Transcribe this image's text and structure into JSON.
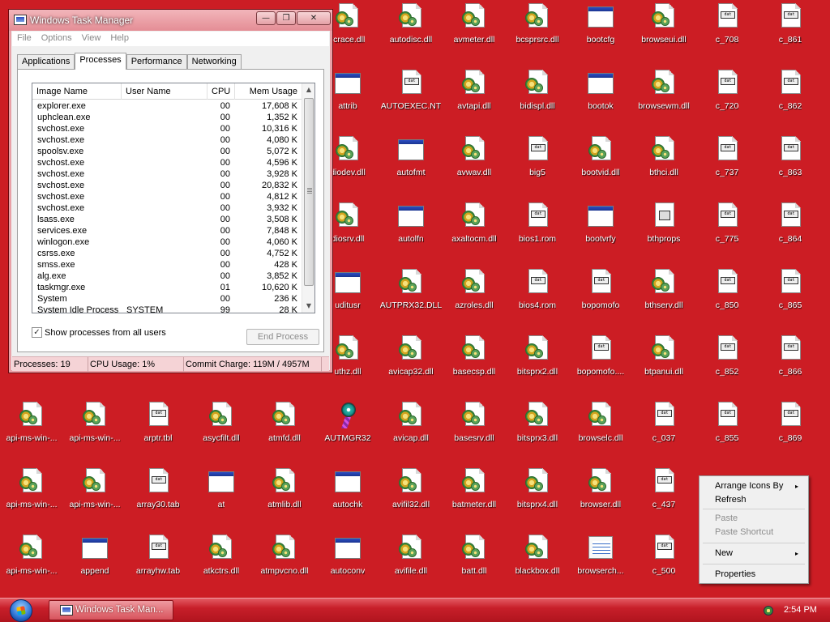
{
  "desktop": {
    "icons": [
      {
        "label": "rcrace.dll",
        "type": "dll",
        "col": 5,
        "row": 0
      },
      {
        "label": "autodisc.dll",
        "type": "dll",
        "col": 6,
        "row": 0
      },
      {
        "label": "avmeter.dll",
        "type": "dll",
        "col": 7,
        "row": 0
      },
      {
        "label": "bcsprsrc.dll",
        "type": "dll",
        "col": 8,
        "row": 0
      },
      {
        "label": "bootcfg",
        "type": "win",
        "col": 9,
        "row": 0
      },
      {
        "label": "browseui.dll",
        "type": "dll",
        "col": 10,
        "row": 0
      },
      {
        "label": "c_708",
        "type": "doc",
        "col": 11,
        "row": 0
      },
      {
        "label": "c_861",
        "type": "doc",
        "col": 12,
        "row": 0
      },
      {
        "label": "attrib",
        "type": "win",
        "col": 5,
        "row": 1
      },
      {
        "label": "AUTOEXEC.NT",
        "type": "doc",
        "col": 6,
        "row": 1
      },
      {
        "label": "avtapi.dll",
        "type": "dll",
        "col": 7,
        "row": 1
      },
      {
        "label": "bidispl.dll",
        "type": "dll",
        "col": 8,
        "row": 1
      },
      {
        "label": "bootok",
        "type": "win",
        "col": 9,
        "row": 1
      },
      {
        "label": "browsewm.dll",
        "type": "dll",
        "col": 10,
        "row": 1
      },
      {
        "label": "c_720",
        "type": "doc",
        "col": 11,
        "row": 1
      },
      {
        "label": "c_862",
        "type": "doc",
        "col": 12,
        "row": 1
      },
      {
        "label": "diodev.dll",
        "type": "dll",
        "col": 5,
        "row": 2
      },
      {
        "label": "autofmt",
        "type": "win",
        "col": 6,
        "row": 2
      },
      {
        "label": "avwav.dll",
        "type": "dll",
        "col": 7,
        "row": 2
      },
      {
        "label": "big5",
        "type": "doc",
        "col": 8,
        "row": 2
      },
      {
        "label": "bootvid.dll",
        "type": "dll",
        "col": 9,
        "row": 2
      },
      {
        "label": "bthci.dll",
        "type": "dll",
        "col": 10,
        "row": 2
      },
      {
        "label": "c_737",
        "type": "doc",
        "col": 11,
        "row": 2
      },
      {
        "label": "c_863",
        "type": "doc",
        "col": 12,
        "row": 2
      },
      {
        "label": "diosrv.dll",
        "type": "dll",
        "col": 5,
        "row": 3
      },
      {
        "label": "autolfn",
        "type": "win",
        "col": 6,
        "row": 3
      },
      {
        "label": "axaltocm.dll",
        "type": "dll",
        "col": 7,
        "row": 3
      },
      {
        "label": "bios1.rom",
        "type": "doc",
        "col": 8,
        "row": 3
      },
      {
        "label": "bootvrfy",
        "type": "win",
        "col": 9,
        "row": 3
      },
      {
        "label": "bthprops",
        "type": "sys",
        "col": 10,
        "row": 3
      },
      {
        "label": "c_775",
        "type": "doc",
        "col": 11,
        "row": 3
      },
      {
        "label": "c_864",
        "type": "doc",
        "col": 12,
        "row": 3
      },
      {
        "label": "uditusr",
        "type": "win",
        "col": 5,
        "row": 4
      },
      {
        "label": "AUTPRX32.DLL",
        "type": "dll",
        "col": 6,
        "row": 4
      },
      {
        "label": "azroles.dll",
        "type": "dll",
        "col": 7,
        "row": 4
      },
      {
        "label": "bios4.rom",
        "type": "doc",
        "col": 8,
        "row": 4
      },
      {
        "label": "bopomofo",
        "type": "doc",
        "col": 9,
        "row": 4
      },
      {
        "label": "bthserv.dll",
        "type": "dll",
        "col": 10,
        "row": 4
      },
      {
        "label": "c_850",
        "type": "doc",
        "col": 11,
        "row": 4
      },
      {
        "label": "c_865",
        "type": "doc",
        "col": 12,
        "row": 4
      },
      {
        "label": "uthz.dll",
        "type": "dll",
        "col": 5,
        "row": 5
      },
      {
        "label": "avicap32.dll",
        "type": "dll",
        "col": 6,
        "row": 5
      },
      {
        "label": "basecsp.dll",
        "type": "dll",
        "col": 7,
        "row": 5
      },
      {
        "label": "bitsprx2.dll",
        "type": "dll",
        "col": 8,
        "row": 5
      },
      {
        "label": "bopomofo....",
        "type": "doc",
        "col": 9,
        "row": 5
      },
      {
        "label": "btpanui.dll",
        "type": "dll",
        "col": 10,
        "row": 5
      },
      {
        "label": "c_852",
        "type": "doc",
        "col": 11,
        "row": 5
      },
      {
        "label": "c_866",
        "type": "doc",
        "col": 12,
        "row": 5
      },
      {
        "label": "api-ms-win-...",
        "type": "dll",
        "col": 0,
        "row": 6
      },
      {
        "label": "api-ms-win-...",
        "type": "dll",
        "col": 1,
        "row": 6
      },
      {
        "label": "arptr.tbl",
        "type": "doc",
        "col": 2,
        "row": 6
      },
      {
        "label": "asycfilt.dll",
        "type": "dll",
        "col": 3,
        "row": 6
      },
      {
        "label": "atmfd.dll",
        "type": "dll",
        "col": 4,
        "row": 6
      },
      {
        "label": "AUTMGR32",
        "type": "cd",
        "col": 5,
        "row": 6
      },
      {
        "label": "avicap.dll",
        "type": "dll",
        "col": 6,
        "row": 6
      },
      {
        "label": "basesrv.dll",
        "type": "dll",
        "col": 7,
        "row": 6
      },
      {
        "label": "bitsprx3.dll",
        "type": "dll",
        "col": 8,
        "row": 6
      },
      {
        "label": "browselc.dll",
        "type": "dll",
        "col": 9,
        "row": 6
      },
      {
        "label": "c_037",
        "type": "doc",
        "col": 10,
        "row": 6
      },
      {
        "label": "c_855",
        "type": "doc",
        "col": 11,
        "row": 6
      },
      {
        "label": "c_869",
        "type": "doc",
        "col": 12,
        "row": 6
      },
      {
        "label": "api-ms-win-...",
        "type": "dll",
        "col": 0,
        "row": 7
      },
      {
        "label": "api-ms-win-...",
        "type": "dll",
        "col": 1,
        "row": 7
      },
      {
        "label": "array30.tab",
        "type": "doc",
        "col": 2,
        "row": 7
      },
      {
        "label": "at",
        "type": "win",
        "col": 3,
        "row": 7
      },
      {
        "label": "atmlib.dll",
        "type": "dll",
        "col": 4,
        "row": 7
      },
      {
        "label": "autochk",
        "type": "win",
        "col": 5,
        "row": 7
      },
      {
        "label": "avifil32.dll",
        "type": "dll",
        "col": 6,
        "row": 7
      },
      {
        "label": "batmeter.dll",
        "type": "dll",
        "col": 7,
        "row": 7
      },
      {
        "label": "bitsprx4.dll",
        "type": "dll",
        "col": 8,
        "row": 7
      },
      {
        "label": "browser.dll",
        "type": "dll",
        "col": 9,
        "row": 7
      },
      {
        "label": "c_437",
        "type": "doc",
        "col": 10,
        "row": 7
      },
      {
        "label": "api-ms-win-...",
        "type": "dll",
        "col": 0,
        "row": 8
      },
      {
        "label": "append",
        "type": "win",
        "col": 1,
        "row": 8
      },
      {
        "label": "arrayhw.tab",
        "type": "doc",
        "col": 2,
        "row": 8
      },
      {
        "label": "atkctrs.dll",
        "type": "dll",
        "col": 3,
        "row": 8
      },
      {
        "label": "atmpvcno.dll",
        "type": "dll",
        "col": 4,
        "row": 8
      },
      {
        "label": "autoconv",
        "type": "win",
        "col": 5,
        "row": 8
      },
      {
        "label": "avifile.dll",
        "type": "dll",
        "col": 6,
        "row": 8
      },
      {
        "label": "batt.dll",
        "type": "dll",
        "col": 7,
        "row": 8
      },
      {
        "label": "blackbox.dll",
        "type": "dll",
        "col": 8,
        "row": 8
      },
      {
        "label": "browserch...",
        "type": "list",
        "col": 9,
        "row": 8
      },
      {
        "label": "c_500",
        "type": "doc",
        "col": 10,
        "row": 8
      }
    ]
  },
  "taskmgr": {
    "title": "Windows Task Manager",
    "caption": {
      "minimize": "—",
      "maximize": "❐",
      "close": "✕"
    },
    "menu": [
      "File",
      "Options",
      "View",
      "Help"
    ],
    "tabs": [
      "Applications",
      "Processes",
      "Performance",
      "Networking"
    ],
    "active_tab": 1,
    "columns": {
      "name": "Image Name",
      "user": "User Name",
      "cpu": "CPU",
      "mem": "Mem Usage"
    },
    "processes": [
      {
        "name": "explorer.exe",
        "user": "",
        "cpu": "00",
        "mem": "17,608 K"
      },
      {
        "name": "uphclean.exe",
        "user": "",
        "cpu": "00",
        "mem": "1,352 K"
      },
      {
        "name": "svchost.exe",
        "user": "",
        "cpu": "00",
        "mem": "10,316 K"
      },
      {
        "name": "svchost.exe",
        "user": "",
        "cpu": "00",
        "mem": "4,080 K"
      },
      {
        "name": "spoolsv.exe",
        "user": "",
        "cpu": "00",
        "mem": "5,072 K"
      },
      {
        "name": "svchost.exe",
        "user": "",
        "cpu": "00",
        "mem": "4,596 K"
      },
      {
        "name": "svchost.exe",
        "user": "",
        "cpu": "00",
        "mem": "3,928 K"
      },
      {
        "name": "svchost.exe",
        "user": "",
        "cpu": "00",
        "mem": "20,832 K"
      },
      {
        "name": "svchost.exe",
        "user": "",
        "cpu": "00",
        "mem": "4,812 K"
      },
      {
        "name": "svchost.exe",
        "user": "",
        "cpu": "00",
        "mem": "3,932 K"
      },
      {
        "name": "lsass.exe",
        "user": "",
        "cpu": "00",
        "mem": "3,508 K"
      },
      {
        "name": "services.exe",
        "user": "",
        "cpu": "00",
        "mem": "7,848 K"
      },
      {
        "name": "winlogon.exe",
        "user": "",
        "cpu": "00",
        "mem": "4,060 K"
      },
      {
        "name": "csrss.exe",
        "user": "",
        "cpu": "00",
        "mem": "4,752 K"
      },
      {
        "name": "smss.exe",
        "user": "",
        "cpu": "00",
        "mem": "428 K"
      },
      {
        "name": "alg.exe",
        "user": "",
        "cpu": "00",
        "mem": "3,852 K"
      },
      {
        "name": "taskmgr.exe",
        "user": "",
        "cpu": "01",
        "mem": "10,620 K"
      },
      {
        "name": "System",
        "user": "",
        "cpu": "00",
        "mem": "236 K"
      },
      {
        "name": "System Idle Process",
        "user": "SYSTEM",
        "cpu": "99",
        "mem": "28 K"
      }
    ],
    "show_all_users_label": "Show processes from all users",
    "show_all_users_checked": true,
    "end_process_label": "End Process",
    "status": {
      "processes": "Processes: 19",
      "cpu": "CPU Usage: 1%",
      "commit": "Commit Charge: 119M / 4957M"
    }
  },
  "context_menu": {
    "items": [
      {
        "label": "Arrange Icons By",
        "submenu": true,
        "disabled": false
      },
      {
        "label": "Refresh",
        "submenu": false,
        "disabled": false
      },
      {
        "label": "Paste",
        "submenu": false,
        "disabled": true
      },
      {
        "label": "Paste Shortcut",
        "submenu": false,
        "disabled": true
      },
      {
        "label": "New",
        "submenu": true,
        "disabled": false
      },
      {
        "label": "Properties",
        "submenu": false,
        "disabled": false
      }
    ]
  },
  "taskbar": {
    "task_button_label": "Windows Task Man...",
    "clock": "2:54 PM"
  },
  "colors": {
    "desktop_bg": "#cc1d24",
    "taskbar": "#c81f2a",
    "titlebar": "#e48d95"
  },
  "icons": {
    "start": "windows-orb-icon",
    "tray": "network-tray-icon",
    "submenu": "▸",
    "scroll_up": "▲",
    "scroll_down": "▼",
    "checkmark": "✓"
  }
}
